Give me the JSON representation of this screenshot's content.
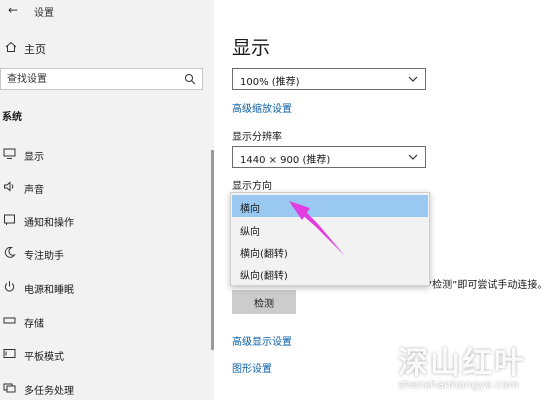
{
  "window": {
    "title": "设置"
  },
  "sidebar": {
    "home_label": "主页",
    "search_placeholder": "查找设置",
    "section_label": "系统",
    "items": [
      {
        "label": "显示",
        "icon": "monitor-icon"
      },
      {
        "label": "声音",
        "icon": "speaker-icon"
      },
      {
        "label": "通知和操作",
        "icon": "notification-icon"
      },
      {
        "label": "专注助手",
        "icon": "moon-icon"
      },
      {
        "label": "电源和睡眠",
        "icon": "power-icon"
      },
      {
        "label": "存储",
        "icon": "storage-icon"
      },
      {
        "label": "平板模式",
        "icon": "tablet-icon"
      },
      {
        "label": "多任务处理",
        "icon": "multitask-icon"
      }
    ]
  },
  "main": {
    "title": "显示",
    "scale_value": "100% (推荐)",
    "advanced_scale_link": "高级缩放设置",
    "resolution_label": "显示分辨率",
    "resolution_value": "1440 × 900 (推荐)",
    "orientation_label": "显示方向",
    "orientation_options": [
      "横向",
      "纵向",
      "横向(翻转)",
      "纵向(翻转)"
    ],
    "detect_hint": "“检测”即可尝试手动连接。",
    "detect_button": "检测",
    "advanced_display_link": "高级显示设置",
    "graphics_link": "图形设置"
  },
  "watermark": {
    "main": "深山红叶",
    "sub": "shenshanhongye.com"
  },
  "colors": {
    "sidebar_bg": "#f2f2f2",
    "link": "#0b5fa5",
    "selected_option": "#99c9f0",
    "arrow": "#e23de0"
  }
}
